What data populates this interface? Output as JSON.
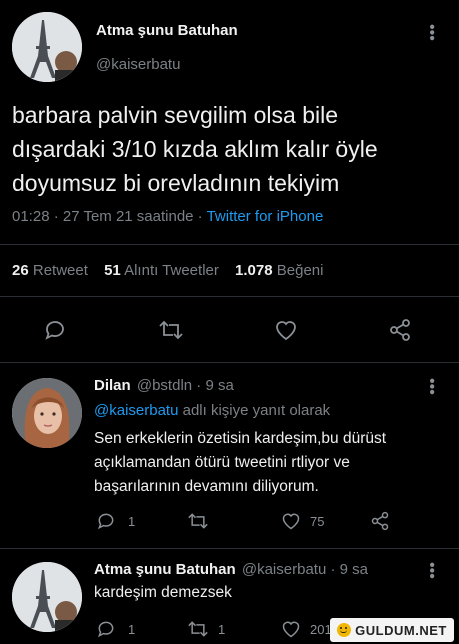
{
  "main_tweet": {
    "author_name": "Atma şunu Batuhan",
    "handle": "@kaiserbatu",
    "text_line1": "barbara palvin sevgilim olsa bile",
    "text_line2": "dışardaki 3/10 kızda aklım kalır öyle",
    "text_line3": "doyumsuz bi orevladının tekiyim",
    "timestamp": "01:28 · 27 Tem 21 saatinde · ",
    "source": "Twitter for iPhone",
    "retweet_count": "26",
    "retweet_label": "Retweet",
    "quote_count": "51",
    "quote_label": "Alıntı Tweetler",
    "like_count": "1.078",
    "like_label": "Beğeni"
  },
  "reply1": {
    "author_name": "Dilan",
    "handle_time": "@bstdln · 9 sa",
    "reply_to_handle": "@kaiserbatu",
    "reply_to_suffix": " adlı kişiye yanıt olarak",
    "text_line1": "Sen erkeklerin özetisin kardeşim,bu dürüst",
    "text_line2": "açıklamandan ötürü tweetini rtliyor ve",
    "text_line3": "başarılarının devamını diliyorum.",
    "reply_count": "1",
    "like_count": "75"
  },
  "reply2": {
    "author_name": "Atma şunu Batuhan",
    "handle_time": "@kaiserbatu · 9 sa",
    "text_line1": "kardeşim demezsek",
    "reply_count": "1",
    "retweet_count": "1",
    "like_count": "201"
  },
  "watermark": "GULDUM.NET",
  "colors": {
    "background": "#000000",
    "accent": "#1d9bf0",
    "muted": "#7b8186"
  }
}
